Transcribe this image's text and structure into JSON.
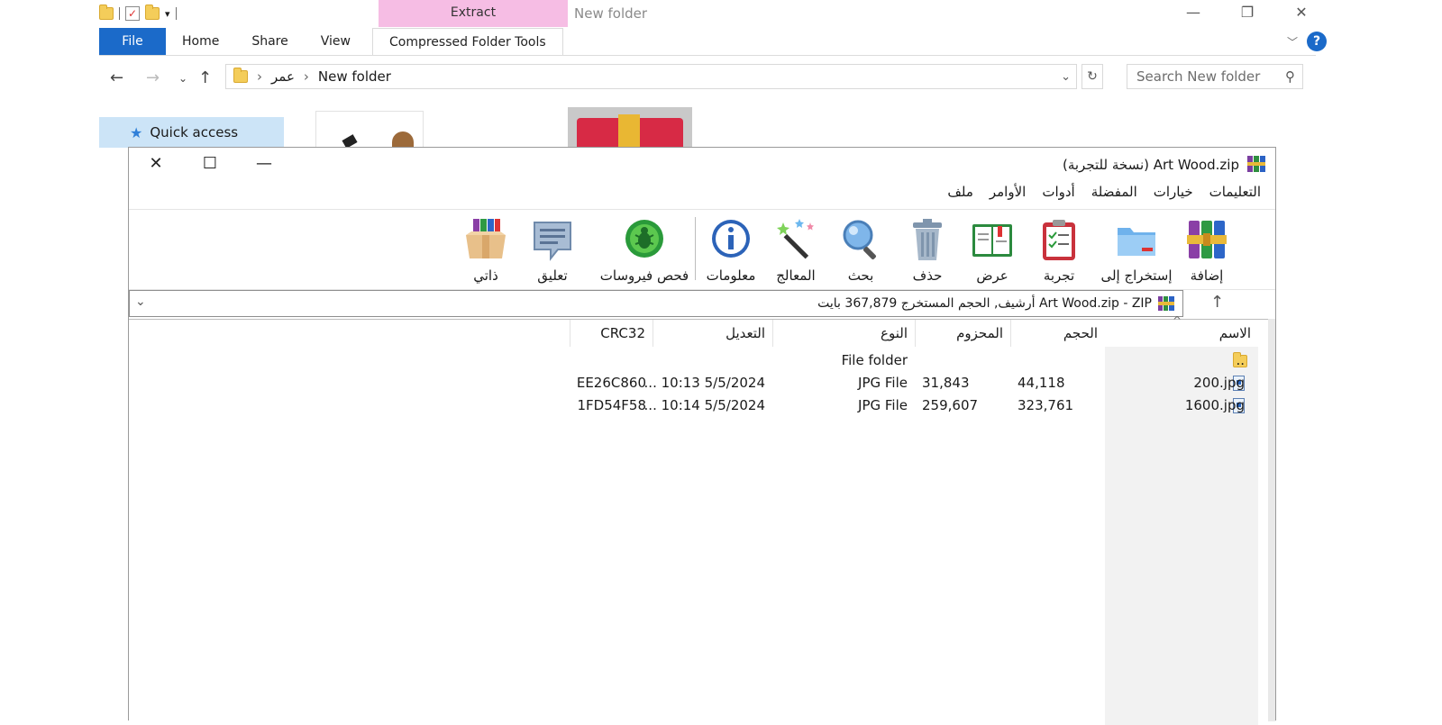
{
  "explorer": {
    "context_tab": "Extract",
    "window_title": "New folder",
    "ribbon_tabs": {
      "file": "File",
      "home": "Home",
      "share": "Share",
      "view": "View",
      "compressed": "Compressed Folder Tools"
    },
    "breadcrumb": [
      "عمر",
      "New folder"
    ],
    "search_placeholder": "Search New folder",
    "nav_pane": {
      "quick_access": "Quick access"
    },
    "help": "?"
  },
  "winrar": {
    "title": "Art Wood.zip (نسخة للتجربة)",
    "menu": [
      "ملف",
      "الأوامر",
      "أدوات",
      "المفضلة",
      "خيارات",
      "التعليمات"
    ],
    "toolbar": [
      {
        "label": "إضافة",
        "icon": "winrar-add-icon"
      },
      {
        "label": "إستخراج إلى",
        "icon": "extract-folder-icon"
      },
      {
        "label": "تجربة",
        "icon": "test-clipboard-icon"
      },
      {
        "label": "عرض",
        "icon": "view-book-icon"
      },
      {
        "label": "حذف",
        "icon": "trash-icon"
      },
      {
        "label": "بحث",
        "icon": "magnifier-icon"
      },
      {
        "label": "المعالج",
        "icon": "wizard-wand-icon"
      },
      {
        "label": "معلومات",
        "icon": "info-icon"
      },
      {
        "label": "فحص فيروسات",
        "icon": "virus-bug-icon"
      },
      {
        "label": "تعليق",
        "icon": "comment-bubble-icon"
      },
      {
        "label": "ذاتي",
        "icon": "sfx-box-icon"
      }
    ],
    "path_text": "Art Wood.zip - ZIP أرشيف, الحجم المستخرج 367,879 بايت",
    "columns": {
      "name": "الاسم",
      "size": "الحجم",
      "packed": "المحزوم",
      "type": "النوع",
      "modified": "التعديل",
      "crc": "CRC32"
    },
    "rows": [
      {
        "name": "..",
        "size": "",
        "packed": "",
        "type": "File folder",
        "modified": "",
        "crc": ""
      },
      {
        "name": "200.jpg",
        "size": "44,118",
        "packed": "31,843",
        "type": "JPG File",
        "modified": "5/5/2024 10:13 ...",
        "crc": "EE26C860"
      },
      {
        "name": "1600.jpg",
        "size": "323,761",
        "packed": "259,607",
        "type": "JPG File",
        "modified": "5/5/2024 10:14 ...",
        "crc": "1FD54F58"
      }
    ]
  }
}
